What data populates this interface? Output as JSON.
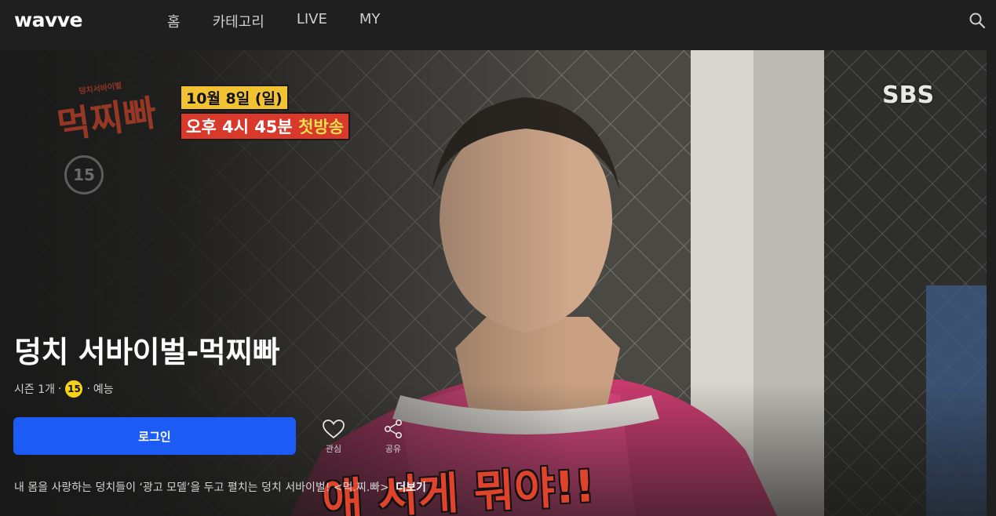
{
  "header": {
    "logo": "wavve",
    "nav": [
      "홈",
      "카테고리",
      "LIVE",
      "MY"
    ]
  },
  "hero": {
    "show_logo": "먹찌빠",
    "show_logo_sub": "덩치서바이벌",
    "age_watermark": "15",
    "air_line1": "10월 8일 (일)",
    "air_line2_a": "오후 4시 45분",
    "air_line2_b": "첫방송",
    "channel": "SBS",
    "caption": "얘 서게 뭐야!!"
  },
  "content": {
    "title": "덩치 서바이벌-먹찌빠",
    "season": "시즌 1개",
    "age": "15",
    "genre": "예능",
    "login_label": "로그인",
    "like_label": "관심",
    "share_label": "공유",
    "description": "내 몸을 사랑하는 덩치들이 ‘광고 모델’을 두고 펼치는 덩치 서바이벌! <먹.찌.빠>",
    "more_label": "더보기"
  },
  "colors": {
    "background": "#1f1f1f",
    "accent": "#1d5bf5",
    "age_badge": "#f7d21b"
  }
}
